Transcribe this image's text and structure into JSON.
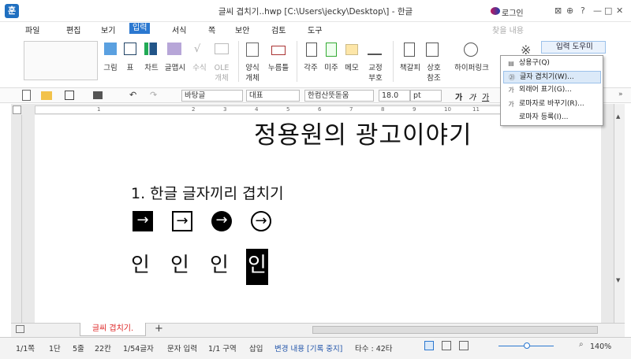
{
  "titlebar": {
    "logo": "훈",
    "title": "글씨 겹치기..hwp [C:\\Users\\jecky\\Desktop\\] - 한글",
    "login": "로그인",
    "window_icons": [
      "⊠",
      "⊕",
      "?",
      "—",
      "□",
      "✕"
    ]
  },
  "menus": [
    "파일",
    "편집",
    "보기",
    "입력",
    "서식",
    "쪽",
    "보안",
    "검토",
    "도구"
  ],
  "search_placeholder": "찾을 내용",
  "ribbon": {
    "groups": [
      {
        "label": "그림"
      },
      {
        "label": "표"
      },
      {
        "label": "차트"
      },
      {
        "label": "글맵시"
      },
      {
        "label": "수식"
      },
      {
        "label": "OLE\n개체"
      },
      {
        "label": "양식\n개체"
      },
      {
        "label": "누름틀"
      },
      {
        "label": "각주"
      },
      {
        "label": "미주"
      },
      {
        "label": "메모"
      },
      {
        "label": "교정\n부호"
      },
      {
        "label": "책갈피"
      },
      {
        "label": "상호\n참조"
      },
      {
        "label": "하이퍼링크"
      }
    ],
    "helper_button": "입력 도우미"
  },
  "format": {
    "style": "바탕글",
    "font_group": "대표",
    "font": "한컴산뜻돋움",
    "size": "18.0",
    "unit": "pt"
  },
  "ruler": {
    "ticks": [
      "1",
      "2",
      "3",
      "4",
      "5",
      "6",
      "7",
      "8",
      "9",
      "10",
      "11"
    ]
  },
  "document": {
    "title": "정용원의 광고이야기",
    "heading": "1. 한글 글자끼리 겹치기",
    "symbols": [
      "→",
      "→",
      "→",
      "→"
    ],
    "chars": [
      "인",
      "인",
      "인",
      "인"
    ]
  },
  "tab": {
    "name": "글씨 겹치기.",
    "add": "+"
  },
  "dropdown": {
    "items": [
      {
        "label": "상용구(Q)",
        "icon": "▤"
      },
      {
        "label": "글자 겹치기(W)...",
        "icon": "㉑"
      },
      {
        "label": "외래어 표기(G)...",
        "icon": "가"
      },
      {
        "label": "로마자로 바꾸기(R)...",
        "icon": "가"
      },
      {
        "label": "로마자 등록(I)...",
        "icon": ""
      }
    ]
  },
  "status": {
    "page": "1/1쪽",
    "dan": "1단",
    "line": "5줄",
    "col": "22칸",
    "chars": "1/54글자",
    "mode": "문자 입력",
    "section": "1/1 구역",
    "insert": "삽입",
    "track": "변경 내용 [기록 중지]",
    "typing": "타수 : 42타",
    "zoom": "140%"
  },
  "colors": {
    "accent": "#2b78d0",
    "tab_text": "#dd2222",
    "track": "#2255aa"
  }
}
